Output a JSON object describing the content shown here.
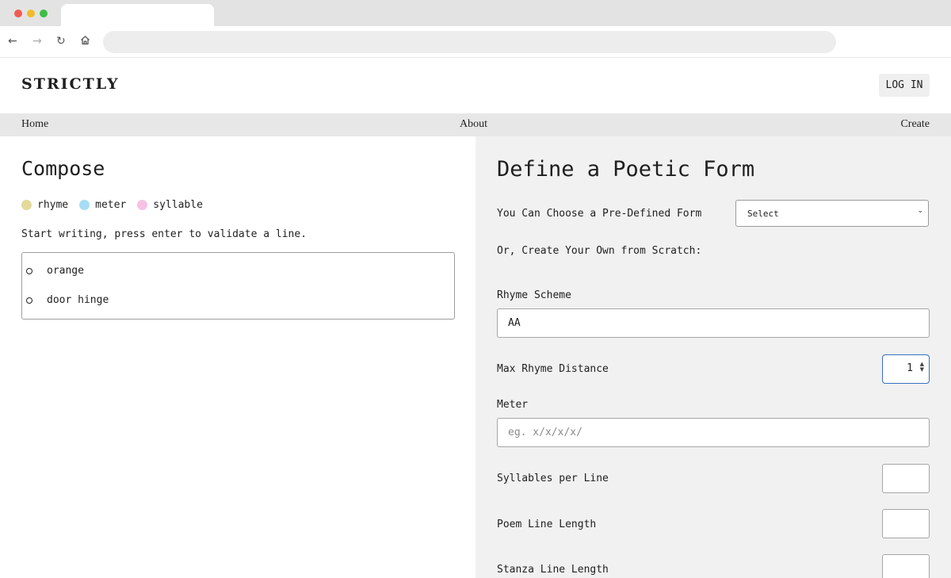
{
  "site": {
    "logo": "STRICTLY",
    "login_label": "LOG IN"
  },
  "nav": {
    "home": "Home",
    "about": "About",
    "create": "Create"
  },
  "compose": {
    "title": "Compose",
    "legend": [
      {
        "label": "rhyme",
        "color": "#e3d99a"
      },
      {
        "label": "meter",
        "color": "#a7dcf5"
      },
      {
        "label": "syllable",
        "color": "#f6c1e5"
      }
    ],
    "instructions": "Start writing, press enter to validate a line.",
    "lines": [
      "orange",
      "door hinge"
    ]
  },
  "define": {
    "title": "Define a Poetic Form",
    "predefined_label": "You Can Choose a Pre-Defined Form",
    "select_value": "Select",
    "scratch_label": "Or, Create Your Own from Scratch:",
    "rhyme_scheme_label": "Rhyme Scheme",
    "rhyme_scheme_value": "AA",
    "max_rhyme_label": "Max Rhyme Distance",
    "max_rhyme_value": "1",
    "meter_label": "Meter",
    "meter_placeholder": "eg. x/x/x/x/",
    "syllables_label": "Syllables per Line",
    "poem_length_label": "Poem Line Length",
    "stanza_length_label": "Stanza Line Length"
  }
}
